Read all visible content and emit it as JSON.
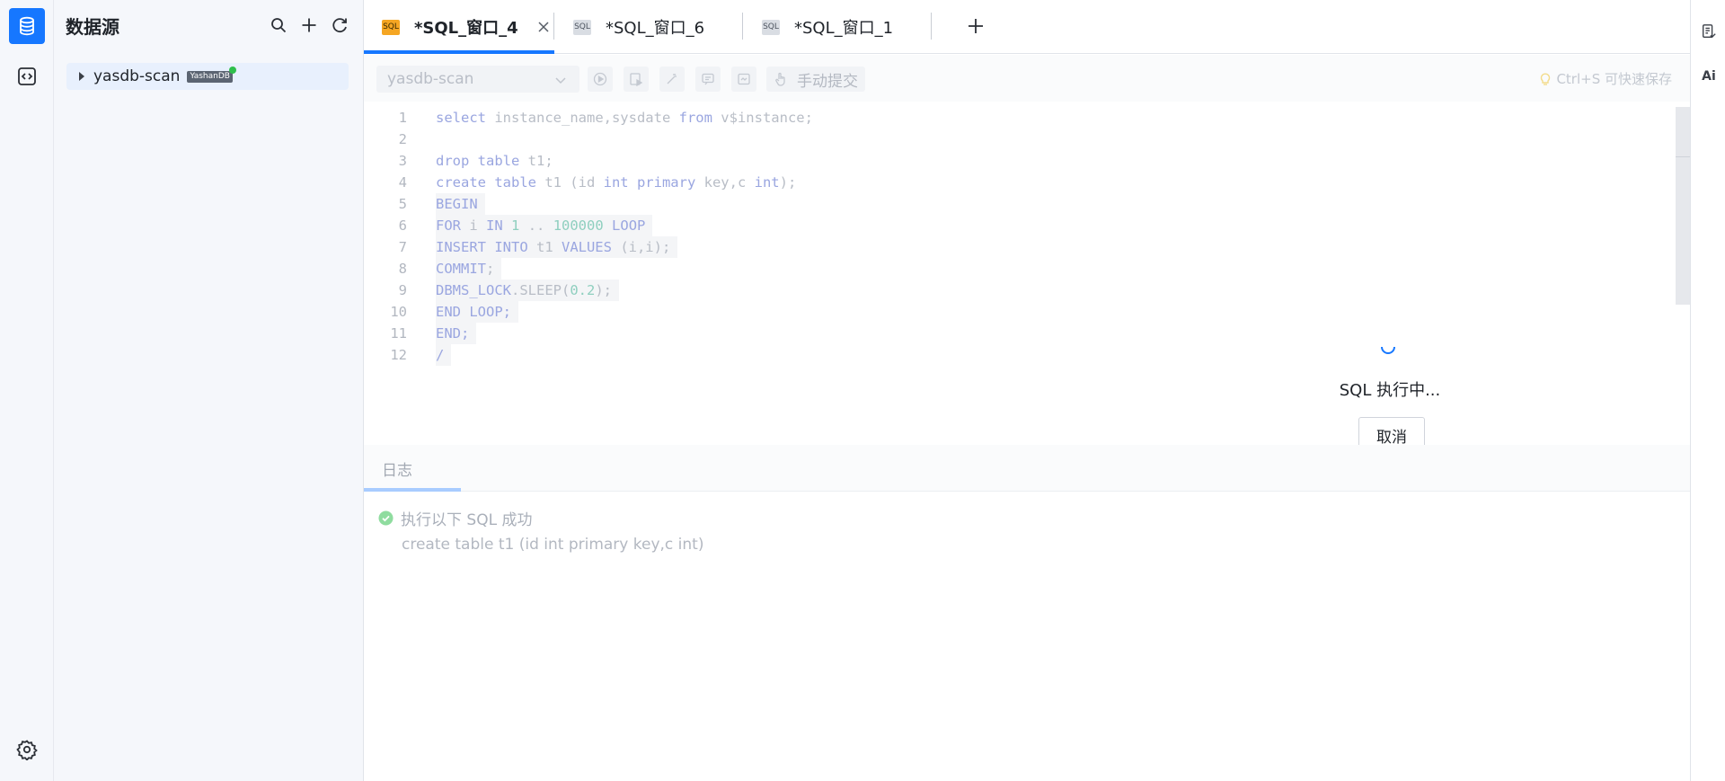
{
  "sidebar": {
    "title": "数据源",
    "tree": [
      {
        "label": "yasdb-scan",
        "badge": "YashanDB",
        "status": "connected"
      }
    ]
  },
  "tabs": [
    {
      "label": "*SQL_窗口_4",
      "icon": "SQL",
      "active": true
    },
    {
      "label": "*SQL_窗口_6",
      "icon": "SQL",
      "active": false
    },
    {
      "label": "*SQL_窗口_1",
      "icon": "SQL",
      "active": false
    }
  ],
  "toolbar": {
    "datasource_value": "yasdb-scan",
    "commit_label": "手动提交",
    "save_hint": "Ctrl+S 可快速保存"
  },
  "editor": {
    "line_numbers": [
      "1",
      "2",
      "3",
      "4",
      "5",
      "6",
      "7",
      "8",
      "9",
      "10",
      "11",
      "12"
    ],
    "lines": [
      "select instance_name,sysdate from v$instance;",
      "",
      "drop table t1;",
      "create table t1 (id int primary key,c int);",
      "BEGIN",
      "FOR i IN 1 .. 100000 LOOP",
      "INSERT INTO t1 VALUES (i,i);",
      "COMMIT;",
      "DBMS_LOCK.SLEEP(0.2);",
      "END LOOP;",
      "END;",
      "/"
    ]
  },
  "execution": {
    "status_text": "SQL 执行中...",
    "cancel_label": "取消"
  },
  "log": {
    "tab_label": "日志",
    "entries": [
      {
        "status": "执行以下 SQL 成功",
        "sql": "create table t1 (id int primary key,c int)"
      }
    ]
  },
  "colors": {
    "accent": "#1677ff",
    "sql_tab_active": "#f5a623",
    "success": "#2fbf4c"
  },
  "right_rail": {
    "ai_label": "Ai"
  }
}
